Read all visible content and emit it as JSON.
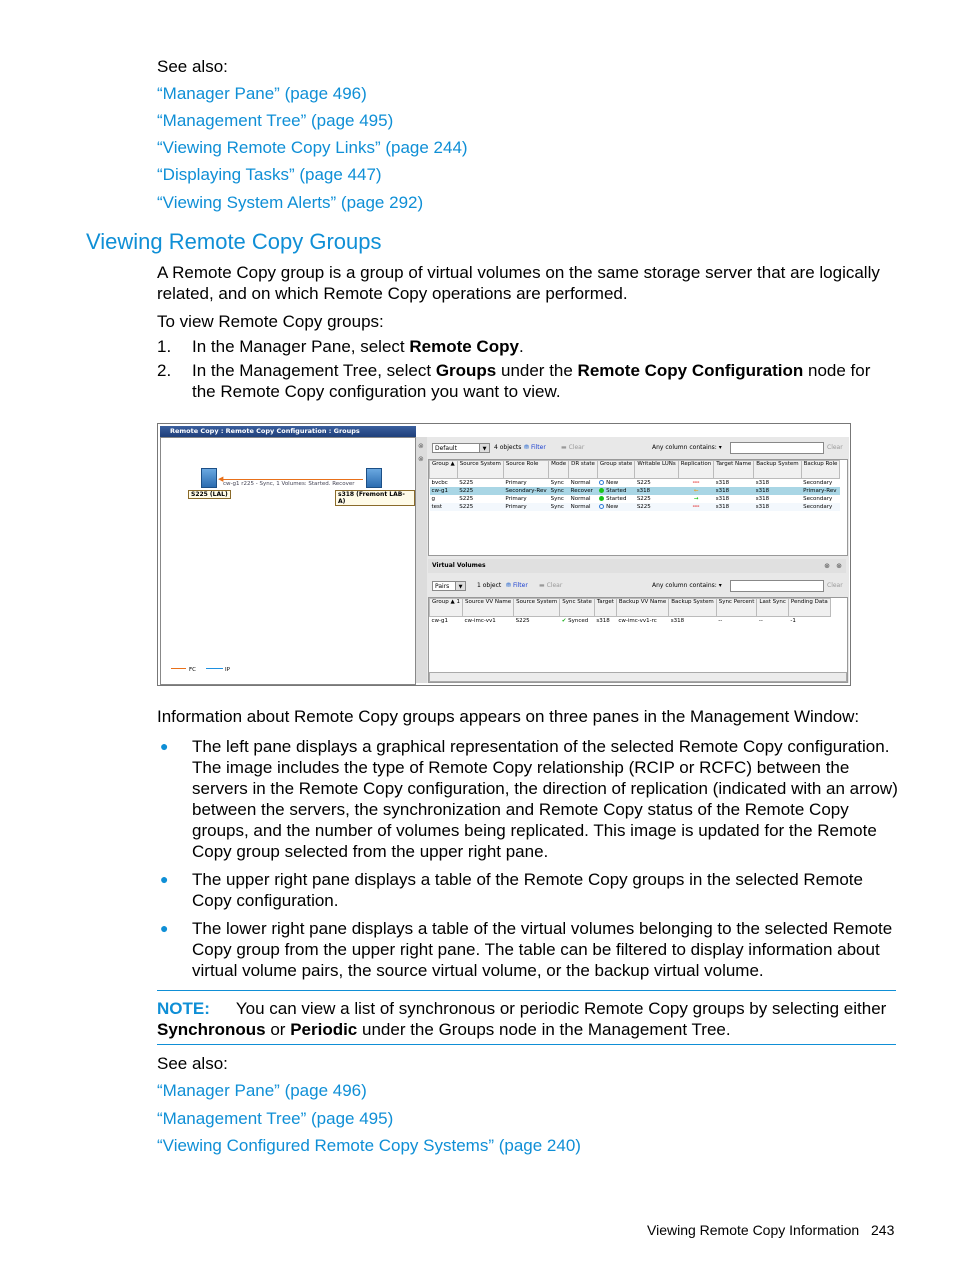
{
  "see_also_top": {
    "label": "See also:",
    "links": [
      "“Manager Pane” (page 496)",
      "“Management Tree” (page 495)",
      "“Viewing Remote Copy Links” (page 244)",
      "“Displaying Tasks” (page 447)",
      "“Viewing System Alerts” (page 292)"
    ]
  },
  "section": {
    "title": "Viewing Remote Copy Groups",
    "intro": "A Remote Copy group is a group of virtual volumes on the same storage server that are logically related, and on which Remote Copy operations are performed.",
    "to_view": "To view Remote Copy groups:",
    "steps": [
      {
        "num": "1.",
        "pre": "In the Manager Pane, select ",
        "b1": "Remote Copy",
        "mid": ".",
        "b2": "",
        "post": ""
      },
      {
        "num": "2.",
        "pre": "In the Management Tree, select ",
        "b1": "Groups",
        "mid": " under the ",
        "b2": "Remote Copy Configuration",
        "post": " node for the Remote Copy configuration you want to view."
      }
    ]
  },
  "screenshot": {
    "title": "Remote Copy : Remote Copy Configuration : Groups",
    "diagram": {
      "link_label": "cw-g1 r225 - Sync, 1 Volumes: Started. Recover",
      "left_server": "S225 (LAL)",
      "right_server": "s318 (Fremont LAB-A)",
      "legend": [
        "FC",
        "IP"
      ],
      "colors": {
        "fc": "#e8701a",
        "ip": "#1e90e0"
      }
    },
    "groups_toolbar": {
      "view": "Default",
      "count": "4 objects",
      "filter": "Filter",
      "clear": "Clear",
      "search_label": "Any column contains:",
      "search_clear": "Clear"
    },
    "groups_table": {
      "columns": [
        "Group",
        "Source System",
        "Source Role",
        "Mode",
        "DR state",
        "Group state",
        "Writable LUNs",
        "Replication",
        "Target Name",
        "Backup System",
        "Backup Role"
      ],
      "rows": [
        {
          "group": "bvcbc",
          "source_system": "S225",
          "source_role": "Primary",
          "mode": "Sync",
          "dr_state": "Normal",
          "group_state": "New",
          "state_icon": "new",
          "writable": "S225",
          "replication": "broken",
          "target": "s318",
          "backup_system": "s318",
          "backup_role": "Secondary"
        },
        {
          "group": "cw-g1",
          "source_system": "S225",
          "source_role": "Secondary-Rev",
          "mode": "Sync",
          "dr_state": "Recover",
          "group_state": "Started",
          "state_icon": "started",
          "writable": "s318",
          "replication": "reverse",
          "target": "s318",
          "backup_system": "s318",
          "backup_role": "Primary-Rev"
        },
        {
          "group": "g",
          "source_system": "S225",
          "source_role": "Primary",
          "mode": "Sync",
          "dr_state": "Normal",
          "group_state": "Started",
          "state_icon": "started",
          "writable": "S225",
          "replication": "forward",
          "target": "s318",
          "backup_system": "s318",
          "backup_role": "Secondary"
        },
        {
          "group": "test",
          "source_system": "S225",
          "source_role": "Primary",
          "mode": "Sync",
          "dr_state": "Normal",
          "group_state": "New",
          "state_icon": "new",
          "writable": "S225",
          "replication": "broken",
          "target": "s318",
          "backup_system": "s318",
          "backup_role": "Secondary"
        }
      ]
    },
    "volumes": {
      "header": "Virtual Volumes",
      "view": "Pairs",
      "count": "1 object",
      "filter": "Filter",
      "clear": "Clear",
      "search_label": "Any column contains:",
      "search_clear": "Clear",
      "columns": [
        "Group",
        "Source VV Name",
        "Source System",
        "Sync State",
        "Target",
        "Backup VV Name",
        "Backup System",
        "Sync Percent",
        "Last Sync",
        "Pending Data"
      ],
      "rows": [
        {
          "group": "cw-g1",
          "source_vv": "cw-imc-vv1",
          "source_system": "S225",
          "sync_state": "Synced",
          "target": "s318",
          "backup_vv": "cw-imc-vv1-rc",
          "backup_system": "s318",
          "sync_percent": "--",
          "last_sync": "--",
          "pending": "-1"
        }
      ]
    }
  },
  "info": {
    "lead": "Information about Remote Copy groups appears on three panes in the Management Window:",
    "bullets": [
      "The left pane displays a graphical representation of the selected Remote Copy configuration. The image includes the type of Remote Copy relationship (RCIP or RCFC) between the servers in the Remote Copy configuration, the direction of replication (indicated with an arrow) between the servers, the synchronization and Remote Copy status of the Remote Copy groups, and the number of volumes being replicated. This image is updated for the Remote Copy group selected from the upper right pane.",
      "The upper right pane displays a table of the Remote Copy groups in the selected Remote Copy configuration.",
      "The lower right pane displays a table of the virtual volumes belonging to the selected Remote Copy group from the upper right pane. The table can be filtered to display information about virtual volume pairs, the source virtual volume, or the backup virtual volume."
    ]
  },
  "note": {
    "label": "NOTE:",
    "text": "You can view a list of synchronous or periodic Remote Copy groups by selecting either ",
    "b1": "Synchronous",
    "mid": " or ",
    "b2": "Periodic",
    "post": " under the Groups node in the Management Tree."
  },
  "see_also_bottom": {
    "label": "See also:",
    "links": [
      "“Manager Pane” (page 496)",
      "“Management Tree” (page 495)",
      "“Viewing Configured Remote Copy Systems” (page 240)"
    ]
  },
  "footer": {
    "section": "Viewing Remote Copy Information",
    "page": "243"
  }
}
